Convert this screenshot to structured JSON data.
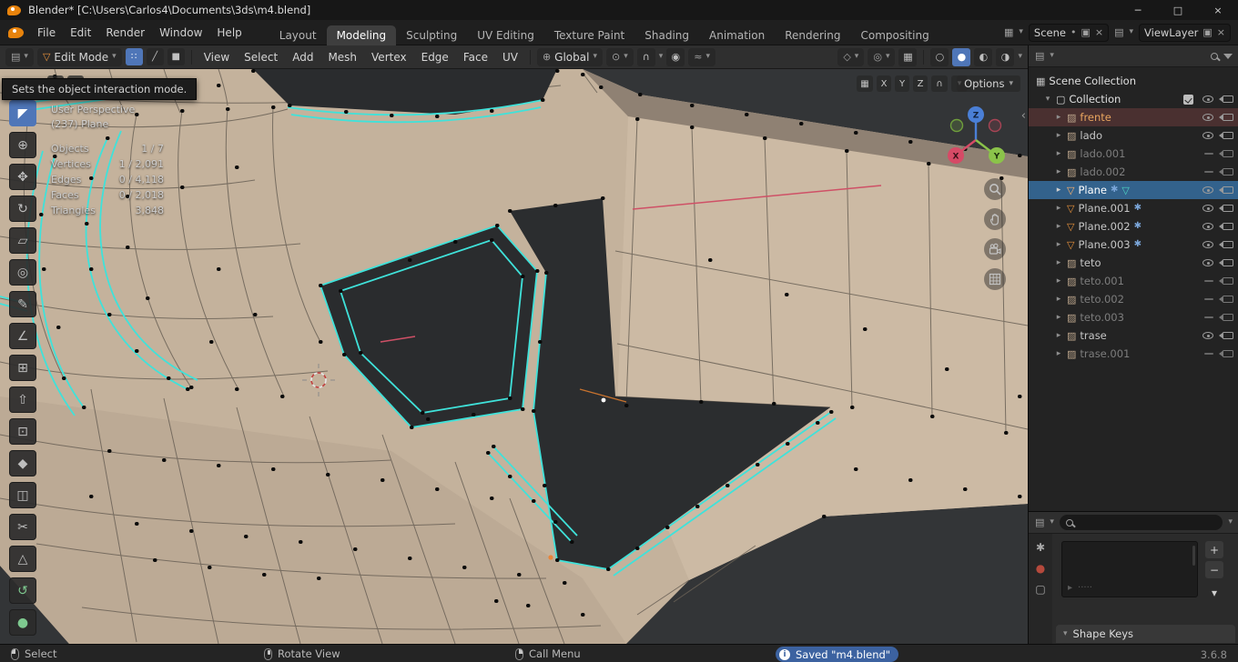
{
  "window": {
    "title": "Blender* [C:\\Users\\Carlos4\\Documents\\3ds\\m4.blend]",
    "controls": {
      "min": "─",
      "max": "□",
      "close": "×"
    }
  },
  "menubar": {
    "menus": [
      "File",
      "Edit",
      "Render",
      "Window",
      "Help"
    ],
    "workspaces": [
      "Layout",
      "Modeling",
      "Sculpting",
      "UV Editing",
      "Texture Paint",
      "Shading",
      "Animation",
      "Rendering",
      "Compositing"
    ],
    "active_workspace": "Modeling",
    "scene_label": "Scene",
    "viewlayer_label": "ViewLayer"
  },
  "header": {
    "mode": "Edit Mode",
    "menus": [
      "View",
      "Select",
      "Add",
      "Mesh",
      "Vertex",
      "Edge",
      "Face",
      "UV"
    ],
    "orientation": "Global",
    "options": "Options",
    "mirror": [
      "X",
      "Y",
      "Z"
    ]
  },
  "tooltip": "Sets the object interaction mode.",
  "viewport": {
    "perspective": "User Perspective",
    "object": "(237) Plane",
    "stats": [
      {
        "label": "Objects",
        "value": "1 / 7"
      },
      {
        "label": "Vertices",
        "value": "1 / 2,091"
      },
      {
        "label": "Edges",
        "value": "0 / 4,118"
      },
      {
        "label": "Faces",
        "value": "0 / 2,018"
      },
      {
        "label": "Triangles",
        "value": "3,848"
      }
    ],
    "axis": {
      "x": "X",
      "y": "Y",
      "z": "Z"
    }
  },
  "tools": [
    {
      "name": "select-box",
      "glyph": "◤"
    },
    {
      "name": "cursor",
      "glyph": "⊕"
    },
    {
      "name": "move",
      "glyph": "✥"
    },
    {
      "name": "rotate",
      "glyph": "↻"
    },
    {
      "name": "scale",
      "glyph": "▱"
    },
    {
      "name": "transform",
      "glyph": "◎"
    },
    {
      "name": "annotate",
      "glyph": "✎"
    },
    {
      "name": "measure",
      "glyph": "∠"
    },
    {
      "name": "add-cube",
      "glyph": "⊞"
    },
    {
      "name": "extrude",
      "glyph": "⇧"
    },
    {
      "name": "inset",
      "glyph": "⊡"
    },
    {
      "name": "bevel",
      "glyph": "◆"
    },
    {
      "name": "loop-cut",
      "glyph": "◫"
    },
    {
      "name": "knife",
      "glyph": "✂"
    },
    {
      "name": "poly-build",
      "glyph": "△"
    },
    {
      "name": "spin",
      "glyph": "↺"
    },
    {
      "name": "smooth",
      "glyph": "●"
    }
  ],
  "outliner": {
    "root": "Scene Collection",
    "collection": "Collection",
    "items": [
      {
        "name": "frente",
        "kind": "image",
        "visible": true,
        "state": "selected"
      },
      {
        "name": "lado",
        "kind": "image",
        "visible": true,
        "state": "normal"
      },
      {
        "name": "lado.001",
        "kind": "image",
        "visible": false,
        "state": "normal"
      },
      {
        "name": "lado.002",
        "kind": "image",
        "visible": false,
        "state": "normal"
      },
      {
        "name": "Plane",
        "kind": "mesh",
        "visible": true,
        "state": "active"
      },
      {
        "name": "Plane.001",
        "kind": "mesh",
        "visible": true,
        "state": "normal"
      },
      {
        "name": "Plane.002",
        "kind": "mesh",
        "visible": true,
        "state": "normal"
      },
      {
        "name": "Plane.003",
        "kind": "mesh",
        "visible": true,
        "state": "normal"
      },
      {
        "name": "teto",
        "kind": "image",
        "visible": true,
        "state": "normal"
      },
      {
        "name": "teto.001",
        "kind": "image",
        "visible": false,
        "state": "normal"
      },
      {
        "name": "teto.002",
        "kind": "image",
        "visible": false,
        "state": "normal"
      },
      {
        "name": "teto.003",
        "kind": "image",
        "visible": false,
        "state": "normal"
      },
      {
        "name": "trase",
        "kind": "image",
        "visible": true,
        "state": "normal"
      },
      {
        "name": "trase.001",
        "kind": "image",
        "visible": false,
        "state": "normal"
      }
    ]
  },
  "properties": {
    "shape_keys": "Shape Keys"
  },
  "statusbar": {
    "select": "Select",
    "rotate": "Rotate View",
    "call_menu": "Call Menu",
    "saved": "Saved \"m4.blend\"",
    "version": "3.6.8"
  },
  "colors": {
    "accent": "#4f76b8",
    "edge_select": "#3fe2da",
    "mesh_orange": "#e8923c",
    "axis_x": "#d64a66",
    "axis_y": "#8bc34a",
    "axis_z": "#4a7fd6"
  },
  "icons": {
    "chev": "▾",
    "tri_r": "▸",
    "tri_d": "▾",
    "back": "‹",
    "mesh": "▽",
    "image": "▨",
    "wrench": "✱",
    "scene": "▦",
    "collection": "▢",
    "editor": "▤",
    "vertex_mode": "∷",
    "edge_mode": "╱",
    "face_mode": "■",
    "orientation": "⊕",
    "pivot": "⊙",
    "magnet": "∩",
    "prop_edit": "◉",
    "falloff": "≈",
    "gizmo": "◇",
    "overlay": "◎",
    "xray": "▦",
    "wire": "○",
    "solid": "●",
    "material": "◐",
    "rendered": "◑",
    "pin": "•",
    "copy": "▣",
    "x": "×",
    "plus": "+",
    "minus": "−",
    "dots": "·····"
  }
}
